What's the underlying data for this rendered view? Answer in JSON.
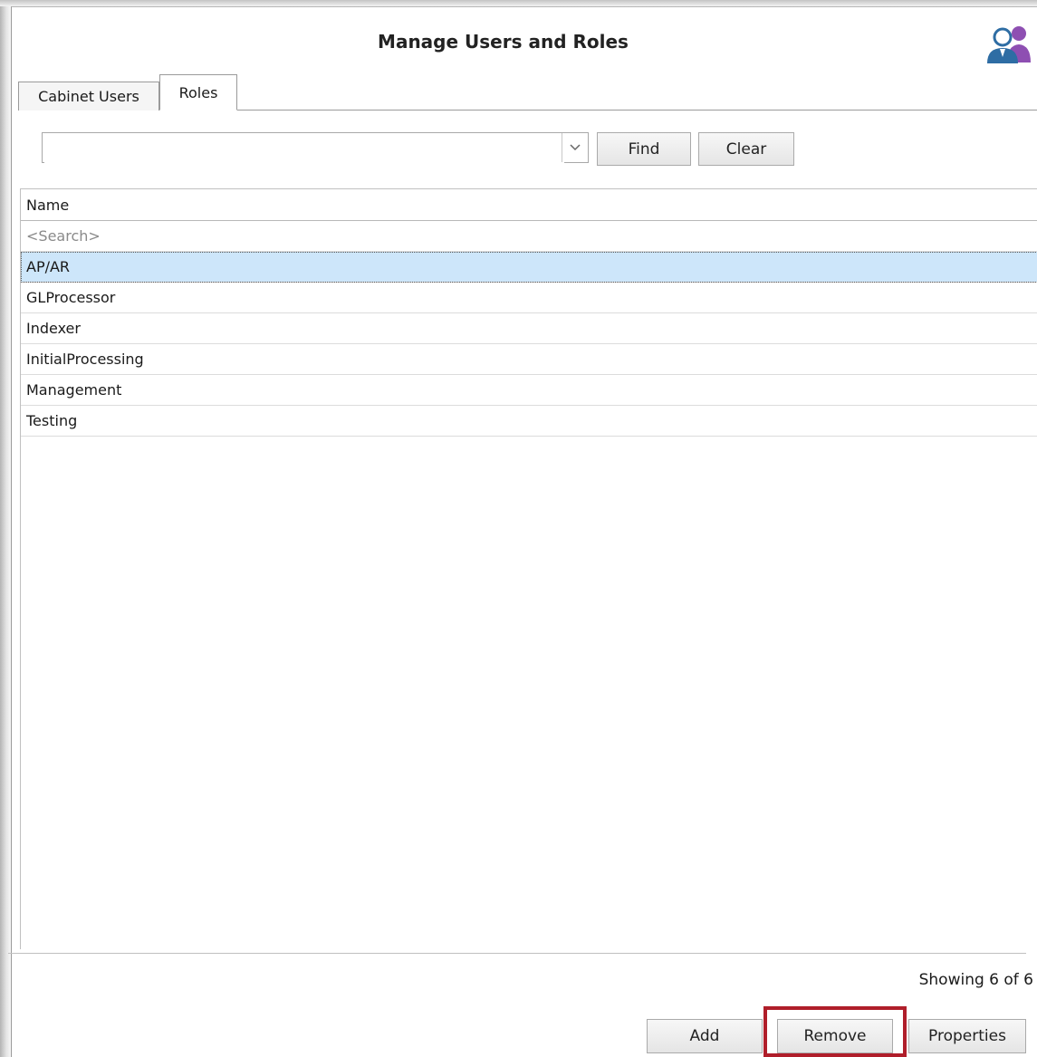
{
  "dialog": {
    "title": "Manage Users and Roles"
  },
  "tabs": [
    {
      "label": "Cabinet Users",
      "active": false
    },
    {
      "label": "Roles",
      "active": true
    }
  ],
  "search": {
    "value": "",
    "find_label": "Find",
    "clear_label": "Clear"
  },
  "grid": {
    "column_header": "Name",
    "search_placeholder": "<Search>",
    "rows": [
      "AP/AR",
      "GLProcessor",
      "Indexer",
      "InitialProcessing",
      "Management",
      "Testing"
    ],
    "selected_index": 0
  },
  "status": {
    "count_text": "Showing 6 of 6"
  },
  "actions": {
    "add_label": "Add",
    "remove_label": "Remove",
    "properties_label": "Properties"
  },
  "colors": {
    "selection": "#cde6fa",
    "highlight_box": "#b01e2a",
    "icon_primary": "#2e6da4",
    "icon_secondary": "#8e4fb2"
  },
  "icons": {
    "title_icon": "users-roles-icon",
    "combo_icon": "chevron-down-icon"
  }
}
